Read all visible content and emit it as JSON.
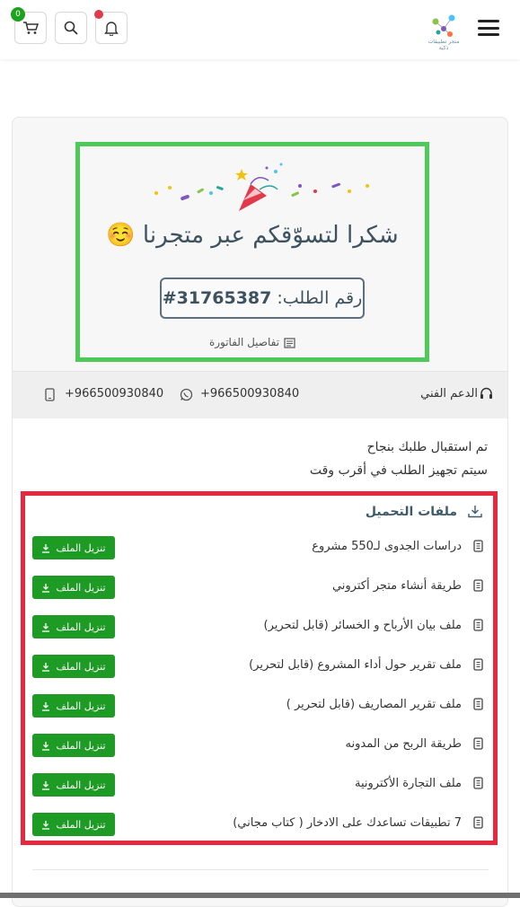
{
  "header": {
    "cart_count": "0",
    "logo_text": "متجر تطبيقات ذكية",
    "icons": [
      "cart-icon",
      "search-icon",
      "bell-icon",
      "menu-icon"
    ]
  },
  "thanks": {
    "title": "شكرا لتسوّقكم عبر متجرنا ☺️",
    "order_label": "رقم الطلب:",
    "order_number": "#31765387",
    "invoice_link": "تفاصيل الفاتورة"
  },
  "support": {
    "label": "الدعم الفني",
    "whatsapp": "+966500930840",
    "phone": "+966500930840"
  },
  "status": {
    "line1": "تم استقبال طلبك بنجاح",
    "line2": "سيتم تجهيز الطلب في أقرب وقت"
  },
  "downloads": {
    "title": "ملفات التحميل",
    "button_label": "تنزيل الملف",
    "items": [
      "دراسات الجدوى لـ550 مشروع",
      "طريقة أنشاء متجر أكتروني",
      "ملف بيان الأرباح و الخسائر (قابل لتحرير)",
      "ملف تقرير حول أداء المشروع (قابل لتحرير)",
      "ملف تقرير المصاريف (قابل لتحرير )",
      "طريقة الربح من المدونه",
      "ملف التجارة الأكترونية",
      "7 تطبيقات تساعدك على الادخار ( كتاب مجاني)"
    ]
  },
  "colors": {
    "accent_green": "#1e9b25",
    "highlight_green": "#4ec95a",
    "highlight_red": "#e8283f",
    "text_dark": "#3d5260"
  }
}
